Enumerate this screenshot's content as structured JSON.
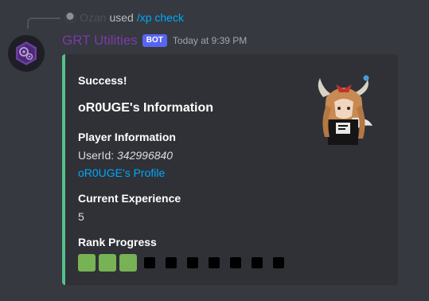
{
  "reply": {
    "user": "Ozan",
    "used_text": "used",
    "command": "/xp check"
  },
  "message": {
    "author": "GRT Utilities",
    "bot_tag": "BOT",
    "timestamp": "Today at 9:39 PM"
  },
  "embed": {
    "author": "Success!",
    "title": "oR0UGE's Information",
    "accent_color": "#57bf8b",
    "fields": {
      "player_info": {
        "name": "Player Information",
        "userid_label": "UserId:",
        "userid_value": "342996840",
        "profile_link": "oR0UGE's Profile"
      },
      "experience": {
        "name": "Current Experience",
        "value": "5"
      },
      "rank": {
        "name": "Rank Progress",
        "filled_segments": 3,
        "total_segments": 10
      }
    }
  },
  "colors": {
    "background": "#36393f",
    "embed_bg": "#2f3136",
    "link": "#00a8fc",
    "progress_filled": "#77b255",
    "progress_empty": "#000000",
    "username": "#7c3aa8",
    "bot_tag": "#5865f2"
  }
}
